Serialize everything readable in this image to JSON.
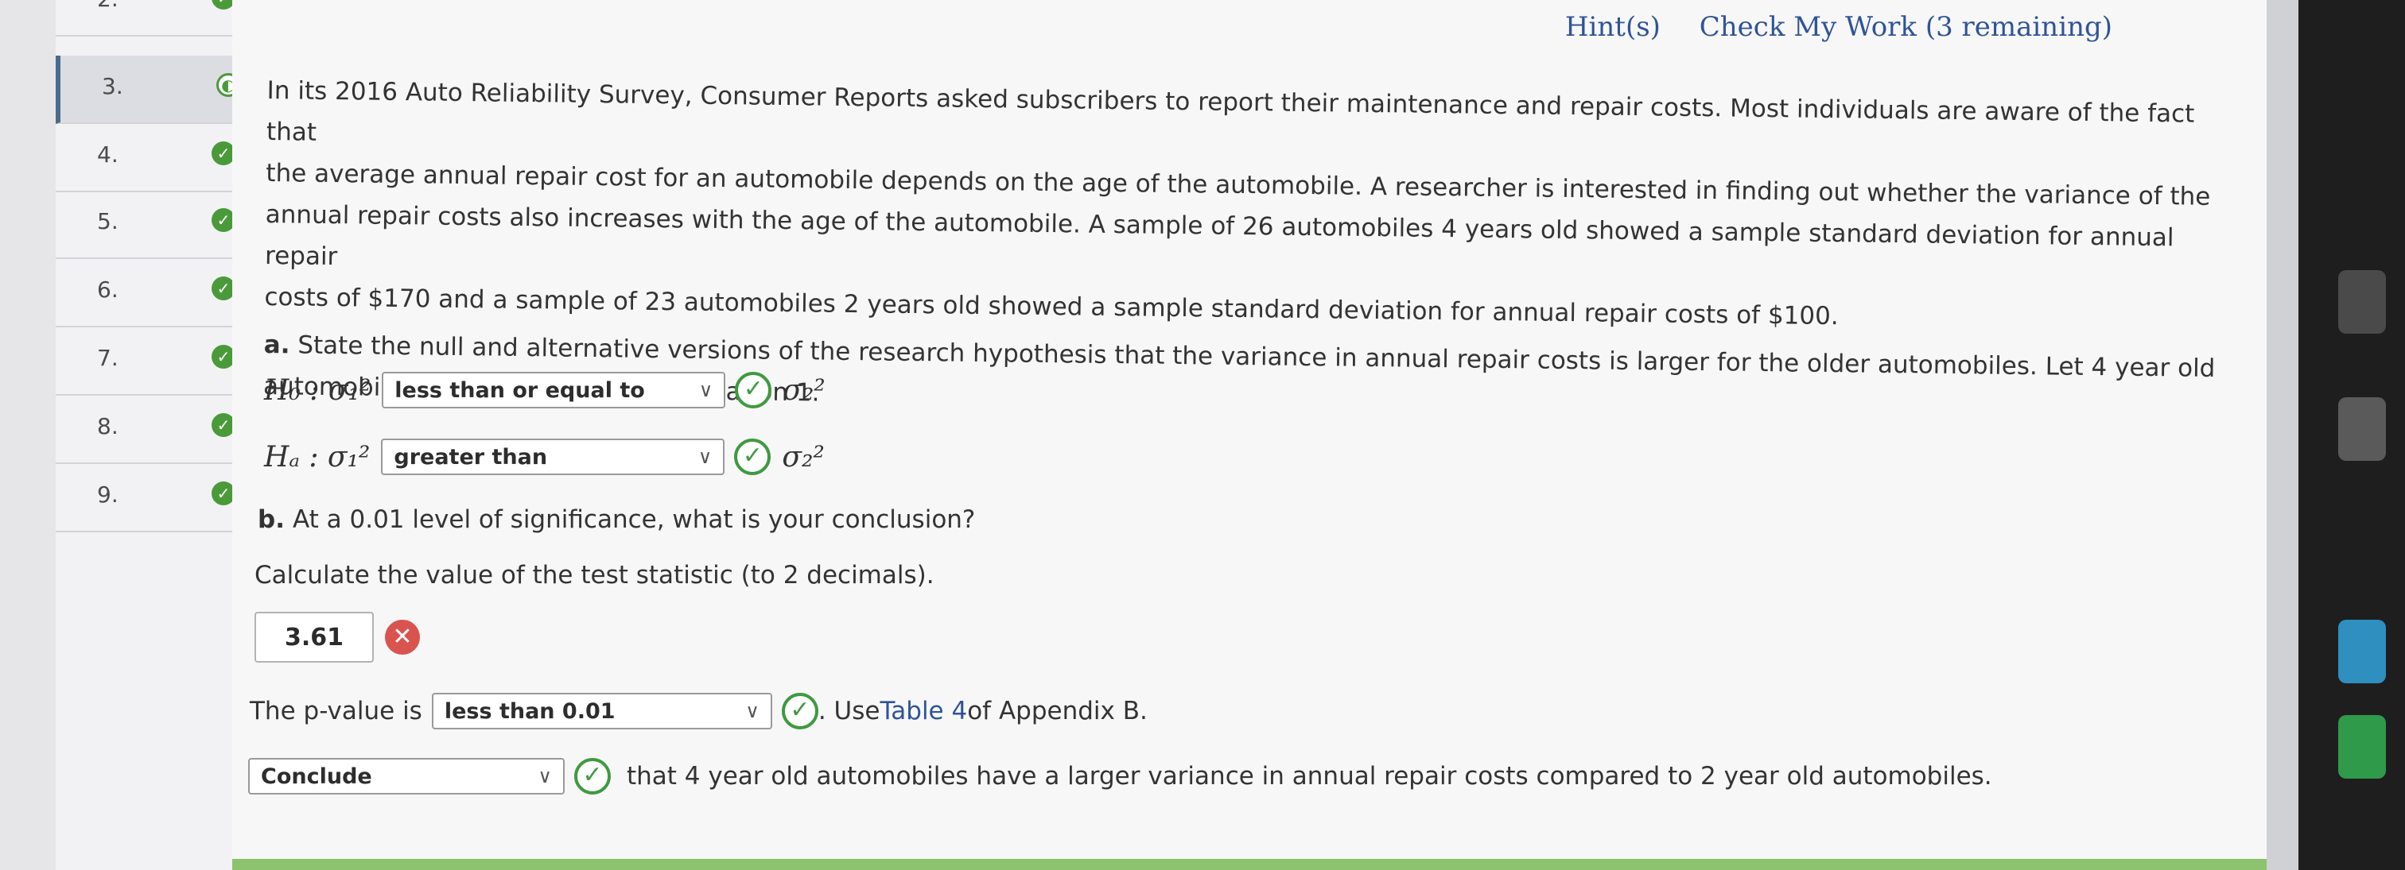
{
  "sidebar": {
    "items": [
      {
        "num": "2."
      },
      {
        "num": "3.",
        "active": true
      },
      {
        "num": "4."
      },
      {
        "num": "5."
      },
      {
        "num": "6."
      },
      {
        "num": "7."
      },
      {
        "num": "8."
      },
      {
        "num": "9."
      }
    ]
  },
  "header": {
    "hints_label": "Hint(s)",
    "check_label": "Check My Work (3 remaining)"
  },
  "problem": {
    "intro_lines": [
      "In its 2016 Auto Reliability Survey, Consumer Reports asked subscribers to report their maintenance and repair costs. Most individuals are aware of the fact that",
      "the average annual repair cost for an automobile depends on the age of the automobile. A researcher is interested in finding out whether the variance of the",
      "annual repair costs also increases with the age of the automobile. A sample of 26 automobiles 4 years old showed a sample standard deviation for annual repair",
      "costs of $170 and a sample of 23 automobiles 2 years old showed a sample standard deviation for annual repair costs of $100."
    ],
    "part_a_label": "a.",
    "part_a_text_1": "State the null and alternative versions of the research hypothesis that the variance in annual repair costs is larger for the older automobiles. Let 4 year old",
    "part_a_text_2": "automobiles be represented by population 1.",
    "h0_label": "H₀ : σ₁²",
    "h0_select": "less than or equal to",
    "ha_label": "Hₐ : σ₁²",
    "ha_select": "greater than",
    "sigma2": "σ₂²",
    "part_b_label": "b.",
    "part_b_text": "At a 0.01 level of significance, what is your conclusion?",
    "calc_text": "Calculate the value of the test statistic (to 2 decimals).",
    "test_stat_value": "3.61",
    "pvalue_prefix": "The p-value is",
    "pvalue_select": "less than 0.01",
    "pvalue_suffix_1": ". Use ",
    "pvalue_link": "Table 4",
    "pvalue_suffix_2": " of Appendix B.",
    "conclude_select": "Conclude",
    "conclude_text": "that 4 year old automobiles have a larger variance in annual repair costs compared to 2 year old automobiles."
  },
  "icons": {
    "check": "check-icon",
    "error": "error-x-icon",
    "chevron": "chevron-down-icon"
  },
  "colors": {
    "link": "#2f5496",
    "success": "#3f9a3f",
    "error": "#d9534f"
  }
}
